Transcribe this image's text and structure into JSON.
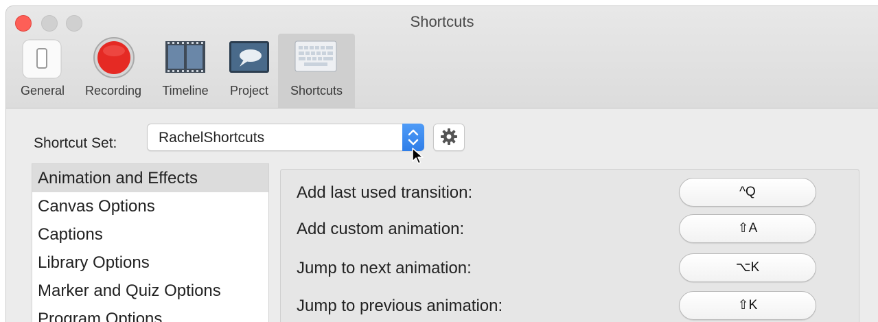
{
  "window": {
    "title": "Shortcuts"
  },
  "toolbar": {
    "items": [
      {
        "label": "General",
        "icon": "general-switch-icon"
      },
      {
        "label": "Recording",
        "icon": "record-icon"
      },
      {
        "label": "Timeline",
        "icon": "timeline-film-icon"
      },
      {
        "label": "Project",
        "icon": "project-icon"
      },
      {
        "label": "Shortcuts",
        "icon": "keyboard-icon",
        "selected": true
      }
    ]
  },
  "shortcut_set": {
    "label": "Shortcut Set:",
    "value": "RachelShortcuts"
  },
  "categories": [
    {
      "label": "Animation and Effects",
      "selected": true
    },
    {
      "label": "Canvas Options"
    },
    {
      "label": "Captions"
    },
    {
      "label": "Library Options"
    },
    {
      "label": "Marker and Quiz Options"
    },
    {
      "label": "Program Options"
    }
  ],
  "shortcuts": [
    {
      "label": "Add last used transition:",
      "keys": "^Q"
    },
    {
      "label": "Add custom animation:",
      "keys": "⇧A"
    },
    {
      "label": "Jump to next animation:",
      "keys": "⌥K"
    },
    {
      "label": "Jump to previous animation:",
      "keys": "⇧K"
    }
  ],
  "colors": {
    "accent": "#3b87f0",
    "record_red": "#e52a24"
  }
}
